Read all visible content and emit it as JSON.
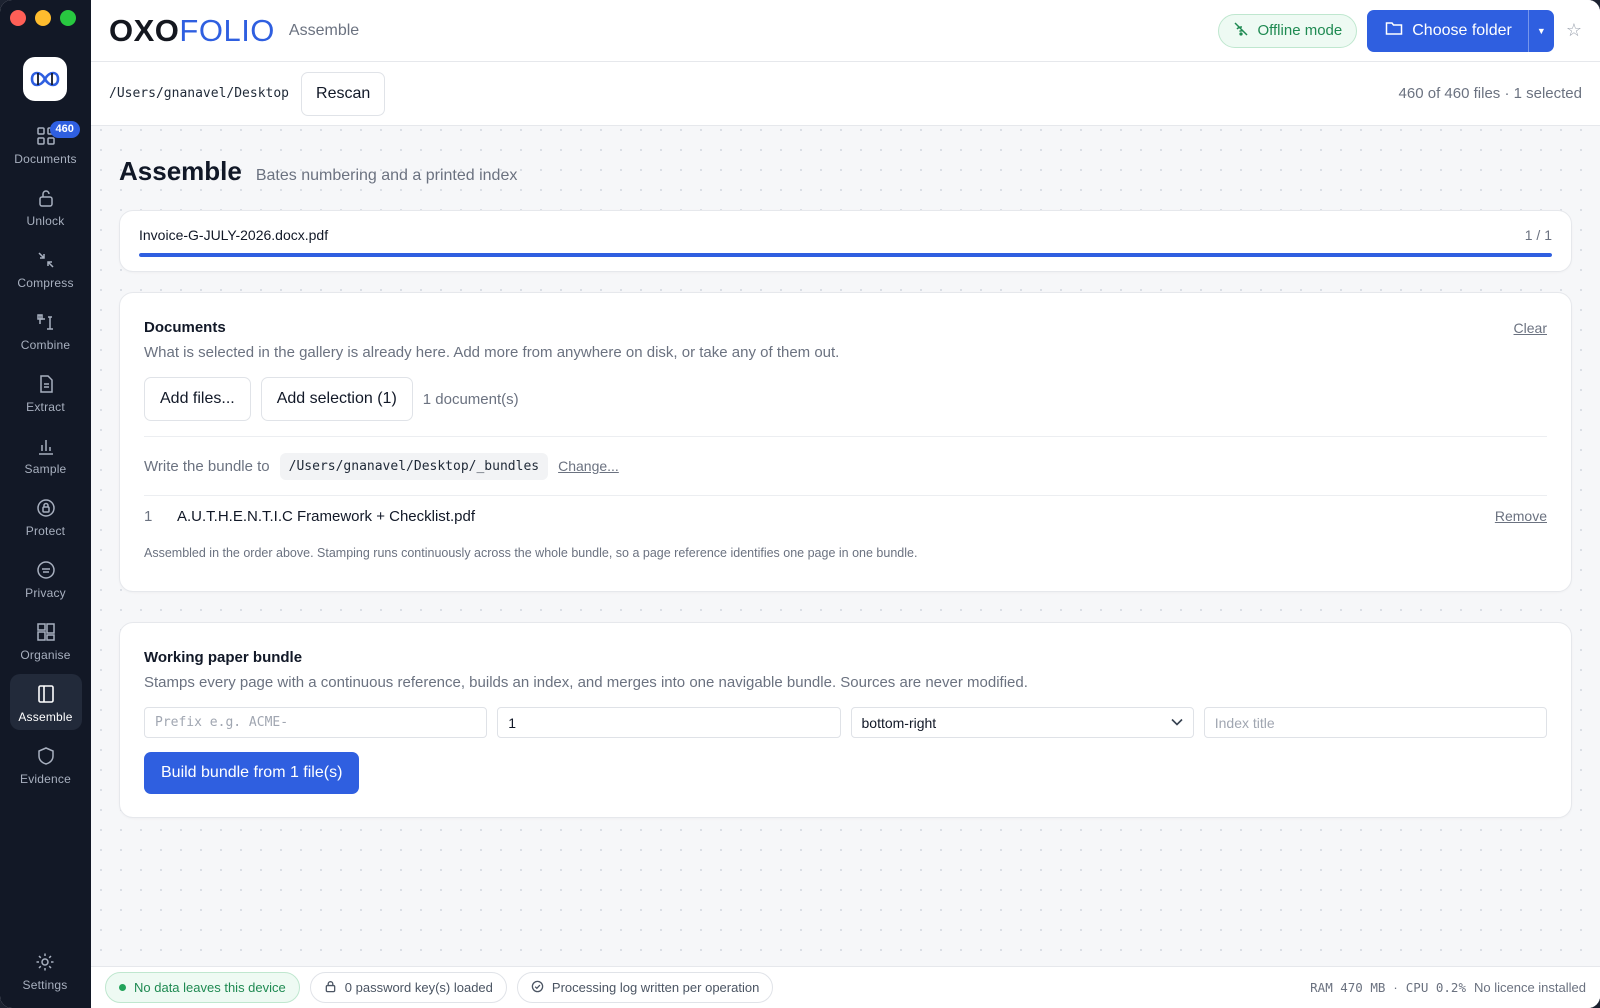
{
  "colors": {
    "accent": "#2f5fe0",
    "sidebar_bg": "#121826",
    "success": "#1f8a52"
  },
  "sidebar": {
    "badge": "460",
    "items": [
      {
        "label": "Documents",
        "icon": "grid-icon"
      },
      {
        "label": "Unlock",
        "icon": "unlock-icon"
      },
      {
        "label": "Compress",
        "icon": "compress-icon"
      },
      {
        "label": "Combine",
        "icon": "combine-icon"
      },
      {
        "label": "Extract",
        "icon": "document-icon"
      },
      {
        "label": "Sample",
        "icon": "bar-chart-icon"
      },
      {
        "label": "Protect",
        "icon": "lock-circle-icon"
      },
      {
        "label": "Privacy",
        "icon": "privacy-icon"
      },
      {
        "label": "Organise",
        "icon": "layout-icon"
      },
      {
        "label": "Assemble",
        "icon": "book-icon"
      },
      {
        "label": "Evidence",
        "icon": "shield-icon"
      }
    ],
    "active": "Assemble",
    "settings_label": "Settings"
  },
  "header": {
    "brand_bold": "OXO",
    "brand_light": "FOLIO",
    "crumb": "Assemble",
    "offline_label": "Offline mode",
    "choose_label": "Choose folder"
  },
  "pathbar": {
    "path": "/Users/gnanavel/Desktop",
    "rescan_label": "Rescan",
    "file_count": "460 of 460 files · 1 selected"
  },
  "page": {
    "title": "Assemble",
    "subtitle": "Bates numbering and a printed index"
  },
  "progress": {
    "file": "Invoice-G-JULY-2026.docx.pdf",
    "count": "1 / 1",
    "fraction": 1.0
  },
  "documents": {
    "title": "Documents",
    "clear_label": "Clear",
    "description": "What is selected in the gallery is already here. Add more from anywhere on disk, or take any of them out.",
    "add_files_label": "Add files...",
    "add_selection_label": "Add selection (1)",
    "doc_count": "1 document(s)",
    "write_label": "Write the bundle to",
    "write_path": "/Users/gnanavel/Desktop/_bundles",
    "change_label": "Change...",
    "list": [
      {
        "index": "1",
        "name": "A.U.T.H.E.N.T.I.C Framework + Checklist.pdf",
        "remove_label": "Remove"
      }
    ],
    "note": "Assembled in the order above. Stamping runs continuously across the whole bundle, so a page reference identifies one page in one bundle."
  },
  "bundle": {
    "title": "Working paper bundle",
    "description": "Stamps every page with a continuous reference, builds an index, and merges into one navigable bundle. Sources are never modified.",
    "prefix_placeholder": "Prefix e.g. ACME-",
    "start_value": "1",
    "position_value": "bottom-right",
    "index_placeholder": "Index title",
    "build_label": "Build bundle from 1 file(s)"
  },
  "status": {
    "privacy": "No data leaves this device",
    "keys": "0 password key(s) loaded",
    "log": "Processing log written per operation",
    "ram": "RAM 470 MB",
    "sep": "·",
    "cpu": "CPU 0.2%",
    "licence": "No licence installed"
  }
}
